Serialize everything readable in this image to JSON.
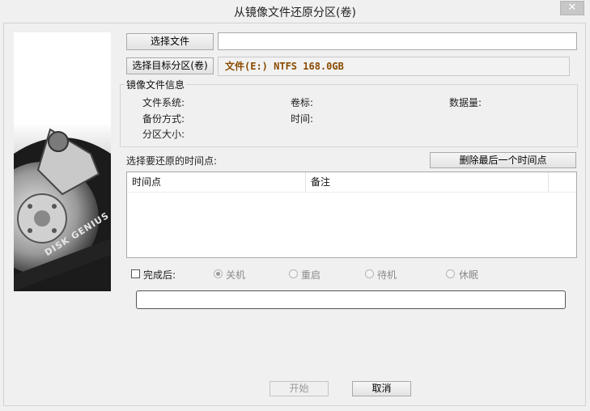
{
  "window": {
    "title": "从镜像文件还原分区(卷)",
    "close_glyph": "✕"
  },
  "file": {
    "select_button": "选择文件",
    "path_value": ""
  },
  "target": {
    "select_button": "选择目标分区(卷)",
    "value": "文件(E:) NTFS 168.0GB"
  },
  "image_info": {
    "group_label": "镜像文件信息",
    "filesystem_label": "文件系统:",
    "volume_label": "卷标:",
    "data_amount_label": "数据量:",
    "backup_mode_label": "备份方式:",
    "time_label": "时间:",
    "partition_size_label": "分区大小:"
  },
  "timepoints": {
    "heading": "选择要还原的时间点:",
    "delete_button": "删除最后一个时间点",
    "columns": [
      "时间点",
      "备注"
    ],
    "rows": []
  },
  "after_complete": {
    "checkbox_label": "完成后:",
    "checked": false,
    "options": [
      "关机",
      "重启",
      "待机",
      "休眠"
    ],
    "selected": "关机"
  },
  "progress": {
    "value": 0
  },
  "actions": {
    "start_button": "开始",
    "cancel_button": "取消"
  },
  "logo": {
    "text": "DISK GENIUS"
  }
}
